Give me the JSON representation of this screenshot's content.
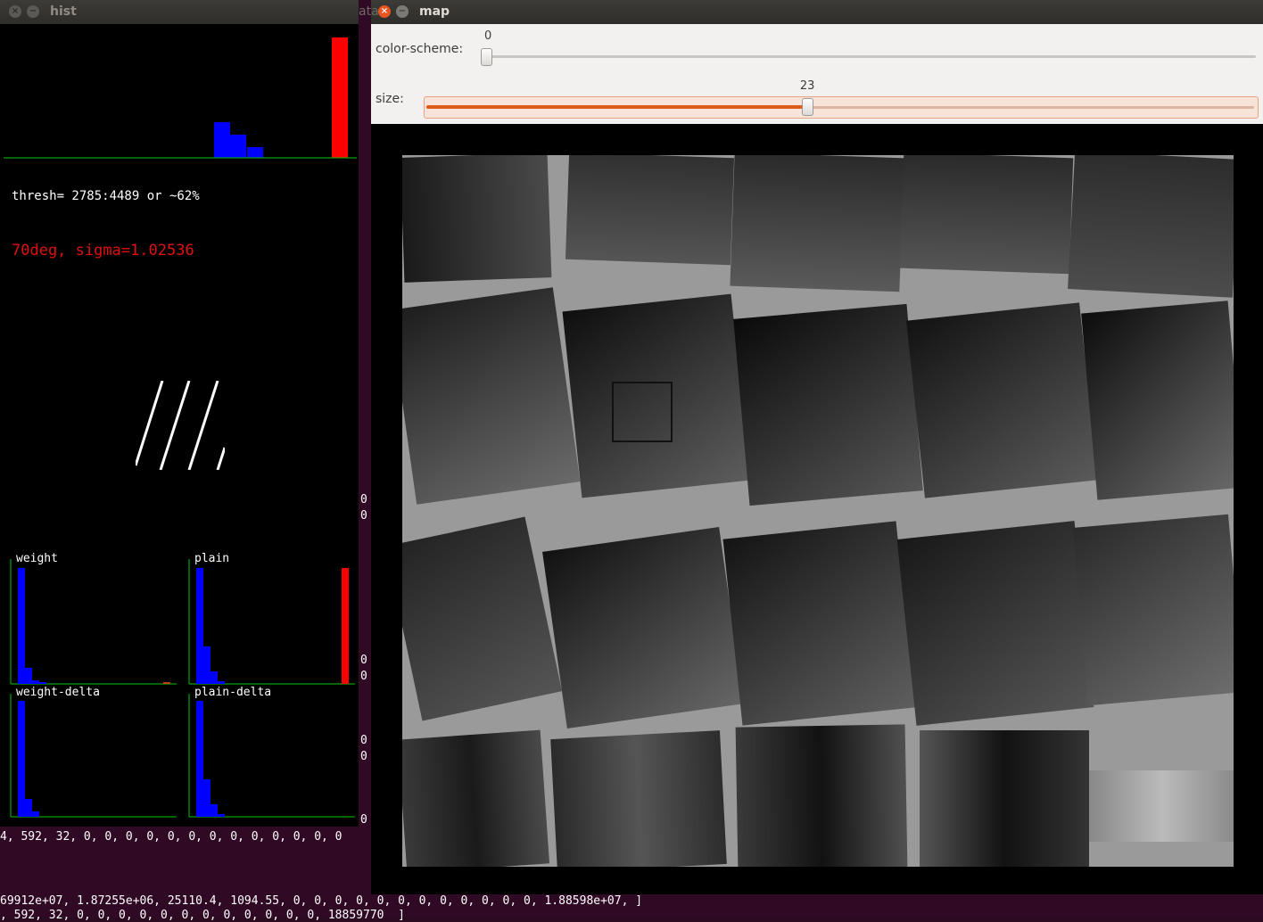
{
  "terminal": {
    "lines": [
      "4, 592, 32, 0, 0, 0, 0, 0, 0, 0, 0, 0, 0, 0, 0, 0",
      "69912e+07, 1.87255e+06, 25110.4, 1094.55, 0, 0, 0, 0, 0, 0, 0, 0, 0, 0, 0, 0, 1.88598e+07, ]",
      ", 592, 32, 0, 0, 0, 0, 0, 0, 0, 0, 0, 0, 0, 0, 18859770  ]"
    ],
    "side_digits": [
      "0",
      "0",
      "0",
      "0",
      "0",
      "0",
      "0",
      "0",
      "0"
    ]
  },
  "hist_window": {
    "title": "hist",
    "thresh_text": "thresh= 2785:4489 or ~62%",
    "angle_text": "70deg, sigma=1.02536",
    "top_histogram": {
      "bars": [
        {
          "value": 40,
          "color": "#0000ff"
        },
        {
          "value": 26,
          "color": "#0000ff"
        },
        {
          "value": 12,
          "color": "#0000ff"
        },
        {
          "value": 135,
          "color": "#ff0000"
        }
      ],
      "axis_color": "#00c800"
    },
    "plots": [
      {
        "label": "weight",
        "bars": [
          130,
          18,
          4,
          2
        ],
        "extra_red": 2
      },
      {
        "label": "plain",
        "bars": [
          130,
          42,
          14,
          3
        ],
        "extra_red": 130
      },
      {
        "label": "weight-delta",
        "bars": [
          130,
          20,
          6
        ],
        "extra_red": 0
      },
      {
        "label": "plain-delta",
        "bars": [
          130,
          42,
          14,
          3
        ],
        "extra_red": 0
      }
    ]
  },
  "map_window": {
    "title": "map",
    "inactive_title_fragment": "ata",
    "controls": {
      "color_scheme": {
        "label": "color-scheme:",
        "value": "0",
        "fraction": 0.0
      },
      "size": {
        "label": "size:",
        "value": "23",
        "fraction": 0.46
      }
    }
  },
  "colors": {
    "close_button": "#e95420",
    "min_button": "#7c7a74",
    "accent": "#e05a1c"
  }
}
